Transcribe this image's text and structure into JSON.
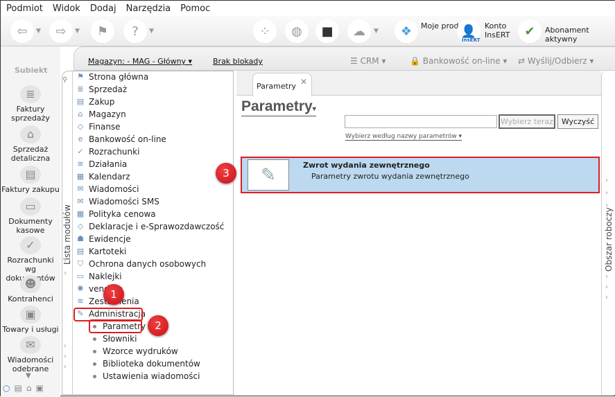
{
  "menu": [
    "Podmiot",
    "Widok",
    "Dodaj",
    "Narzędzia",
    "Pomoc"
  ],
  "toolbar": {
    "moje_produkty": "Moje produkty",
    "konto": "Konto InsERT",
    "insert_badge": "InsERT",
    "abonament": "Abonament aktywny"
  },
  "sidebar": {
    "brand": "Subiekt",
    "items": [
      "Faktury sprzedaży",
      "Sprzedaż detaliczna",
      "Faktury zakupu",
      "Dokumenty kasowe",
      "Rozrachunki wg dokumentów",
      "Kontrahenci",
      "Towary i usługi",
      "Wiadomości odebrane"
    ]
  },
  "header": {
    "magazyn": "Magazyn: - MAG - Główny",
    "blokada": "Brak blokady",
    "crm": "CRM",
    "bankowosc": "Bankowość on-line",
    "wyslij": "Wyślij/Odbierz"
  },
  "modules": {
    "title": "Lista modułów",
    "items": [
      "Strona główna",
      "Sprzedaż",
      "Zakup",
      "Magazyn",
      "Finanse",
      "Bankowość on-line",
      "Rozrachunki",
      "Działania",
      "Kalendarz",
      "Wiadomości",
      "Wiadomości SMS",
      "Polityka cenowa",
      "Deklaracje i e-Sprawozdawczość",
      "Ewidencje",
      "Kartoteki",
      "Ochrona danych osobowych",
      "Naklejki",
      "vendero",
      "Zestawienia",
      "Administracja"
    ],
    "subitems": [
      "Parametry",
      "Słowniki",
      "Wzorce wydruków",
      "Biblioteka dokumentów",
      "Ustawienia wiadomości"
    ]
  },
  "main": {
    "tab": "Parametry",
    "title": "Parametry",
    "search_value": "",
    "select_now": "Wybierz teraz",
    "clear": "Wyczyść",
    "filter": "Wybierz według nazwy parametrów",
    "result": {
      "title": "Zwrot wydania zewnętrznego",
      "desc": "Parametry zwrotu wydania zewnętrznego"
    }
  },
  "workspace": "Obszar roboczy",
  "markers": [
    "1",
    "2",
    "3"
  ],
  "colors": {
    "highlight": "#e01b24",
    "selected_row": "#bcd9f0"
  }
}
